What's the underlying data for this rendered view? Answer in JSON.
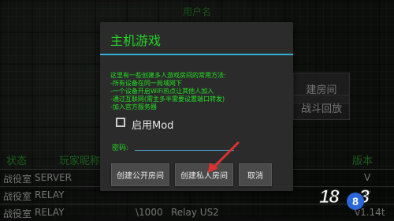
{
  "background": {
    "top_label": "用户名",
    "right_button_1": "建房间",
    "right_button_2": "战斗回放",
    "table_headers": {
      "status": "状态",
      "player_name": "玩家昵称",
      "version": "版本"
    },
    "rows": [
      {
        "status": "战役室",
        "type": "SERVER"
      },
      {
        "status": "战役室",
        "type": "RELAY"
      },
      {
        "status": "战役室",
        "type": "RELAY",
        "players": "\\1000",
        "relay": "Relay US2",
        "version": "v1.14t"
      }
    ],
    "row_version_v": "V",
    "row_version_v2": "V"
  },
  "dialog": {
    "title": "主机游戏",
    "description": [
      "这里有一些创建多人游戏房间的常用方法:",
      "-所有设备在同一局域网下",
      "-一个设备开启WiFi热点让其他人加入",
      "-通过互联网(需主多半需要设置端口转发)",
      "-加入官方服务器"
    ],
    "mod_checkbox_label": "启用Mod",
    "mod_checked": false,
    "password_label": "密码:",
    "password_value": "",
    "buttons": {
      "public_room": "创建公开房间",
      "private_room": "创建私人房间",
      "cancel": "取消"
    }
  },
  "watermark": {
    "text_a": "18",
    "text_b": "3",
    "circle": "8"
  },
  "colors": {
    "accent_green": "#23d423",
    "divider_blue": "#2db0d6",
    "dialog_bg": "#2b2b2b",
    "arrow_red": "#e03030"
  },
  "icons": {
    "annotation": "red-arrow-icon"
  }
}
